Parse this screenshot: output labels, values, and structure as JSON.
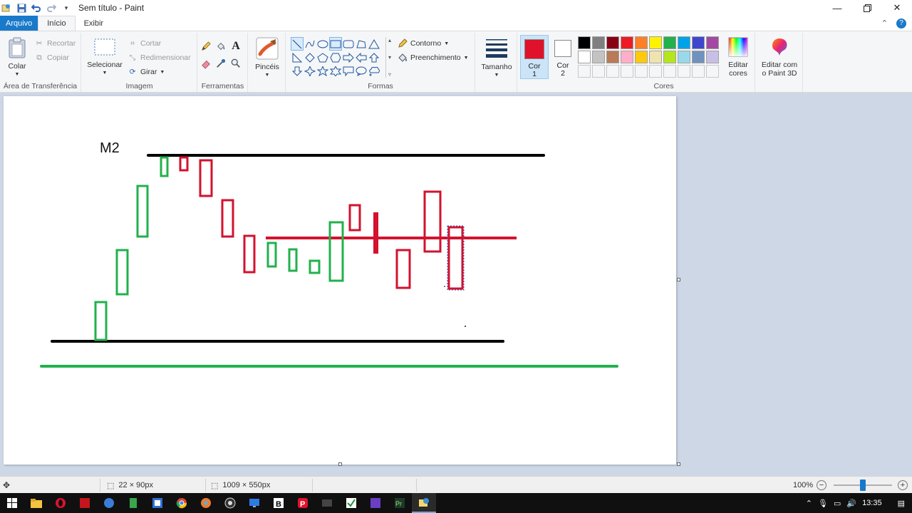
{
  "window": {
    "title": "Sem título - Paint",
    "controls": [
      "minimize",
      "restore",
      "close"
    ]
  },
  "tabs": {
    "file": "Arquivo",
    "home": "Início",
    "view": "Exibir"
  },
  "clipboard": {
    "paste": "Colar",
    "cut": "Recortar",
    "copy": "Copiar",
    "label": "Área de Transferência"
  },
  "image": {
    "select": "Selecionar",
    "crop": "Cortar",
    "resize": "Redimensionar",
    "rotate": "Girar",
    "label": "Imagem"
  },
  "tools": {
    "label": "Ferramentas",
    "items": [
      "pencil-icon",
      "fill-icon",
      "text-icon",
      "eraser-icon",
      "color-picker-icon",
      "magnifier-icon"
    ]
  },
  "brushes": {
    "label": "Pincéis"
  },
  "shapes": {
    "label": "Formas",
    "outline": "Contorno",
    "fill": "Preenchimento",
    "selected": "line"
  },
  "size": {
    "label": "Tamanho"
  },
  "color1": {
    "label": "Cor\n1",
    "l1": "Cor",
    "l2": "1",
    "value": "#e0112b"
  },
  "color2": {
    "l1": "Cor",
    "l2": "2",
    "value": "#ffffff"
  },
  "colors": {
    "label": "Cores",
    "edit": "Editar cores",
    "edit_l1": "Editar",
    "edit_l2": "cores",
    "row1": [
      "#000000",
      "#7f7f7f",
      "#880015",
      "#ed1c24",
      "#ff7f27",
      "#fff200",
      "#22b14c",
      "#00a2e8",
      "#3f48cc",
      "#a349a4"
    ],
    "row2": [
      "#ffffff",
      "#c3c3c3",
      "#b97a57",
      "#ffaec9",
      "#ffc90e",
      "#efe4b0",
      "#b5e61d",
      "#99d9ea",
      "#7092be",
      "#c8bfe7"
    ]
  },
  "paint3d": {
    "l1": "Editar com",
    "l2": "o Paint 3D"
  },
  "canvas": {
    "label_text": "M2",
    "colors": {
      "black": "#000000",
      "green": "#22b14c",
      "red": "#d2122e"
    }
  },
  "status": {
    "selection_size": "22 × 90px",
    "canvas_size": "1009 × 550px",
    "zoom": "100%"
  },
  "taskbar": {
    "time": "13:35"
  }
}
